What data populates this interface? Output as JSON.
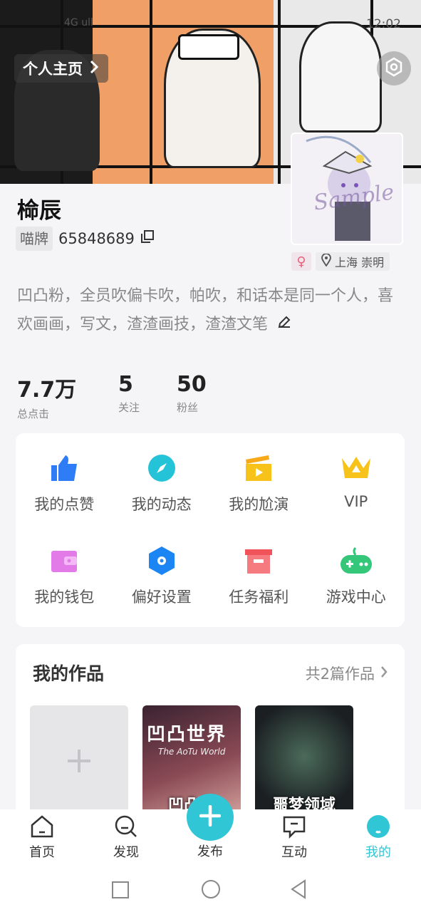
{
  "status_bar": {
    "signal": "4G ull",
    "time": "12:02"
  },
  "header": {
    "profile_link_label": "个人主页"
  },
  "profile": {
    "name": "椧辰",
    "badge": "喵牌",
    "uid": "65848689",
    "gender": "♀",
    "location": "上海 崇明",
    "avatar_watermark": "Sample",
    "bio": "凹凸粉，全员吹偏卡吹，帕吹，和话本是同一个人，喜欢画画，写文，渣渣画技，渣渣文笔"
  },
  "stats": [
    {
      "value": "7.7万",
      "label": "总点击"
    },
    {
      "value": "5",
      "label": "关注"
    },
    {
      "value": "50",
      "label": "粉丝"
    }
  ],
  "menu": [
    {
      "label": "我的点赞",
      "icon": "thumbs-up-icon",
      "color": "#2f7df6"
    },
    {
      "label": "我的动态",
      "icon": "compass-icon",
      "color": "#25c3d8"
    },
    {
      "label": "我的尬演",
      "icon": "clapperboard-icon",
      "color": "#f7c21a"
    },
    {
      "label": "VIP",
      "icon": "crown-icon",
      "color": "#f7c21a"
    },
    {
      "label": "我的钱包",
      "icon": "wallet-icon",
      "color": "#e27ae8"
    },
    {
      "label": "偏好设置",
      "icon": "hexagon-settings-icon",
      "color": "#1b86f3"
    },
    {
      "label": "任务福利",
      "icon": "gift-box-icon",
      "color": "#f0545a"
    },
    {
      "label": "游戏中心",
      "icon": "gamepad-icon",
      "color": "#34c77a"
    }
  ],
  "works": {
    "title": "我的作品",
    "count_label": "共2篇作品",
    "items": [
      {
        "caption": "凹凸世",
        "overlay_title": "凹凸世界",
        "overlay_sub": "The AoTu World"
      },
      {
        "caption": "噩梦领域"
      }
    ]
  },
  "tabbar": [
    {
      "label": "首页",
      "icon": "home-icon"
    },
    {
      "label": "发现",
      "icon": "discover-icon"
    },
    {
      "label": "发布",
      "icon": "plus-icon"
    },
    {
      "label": "互动",
      "icon": "chat-icon"
    },
    {
      "label": "我的",
      "icon": "me-icon"
    }
  ],
  "colors": {
    "accent": "#30c6d6",
    "banner_orange": "#f0a067"
  }
}
